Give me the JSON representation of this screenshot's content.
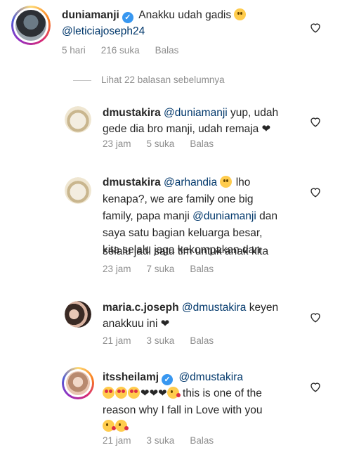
{
  "comment": {
    "username": "duniamanji",
    "text": "Anakku udah gadis",
    "emoji": "grinning-face",
    "mention": "@leticiajoseph24",
    "time": "5 hari",
    "likes": "216 suka",
    "reply": "Balas"
  },
  "view_previous": "Lihat 22 balasan sebelumnya",
  "replies": [
    {
      "username": "dmustakira",
      "mention": "@duniamanji",
      "line1": " yup, udah",
      "line2": "gede dia bro manji, udah remaja",
      "time": "23 jam",
      "likes": "5 suka",
      "reply": "Balas"
    },
    {
      "username": "dmustakira",
      "mention": "@arhandia",
      "line1_tail": "lho",
      "line2": "kenapa?, we are family one big",
      "line3_pre": "family, papa manji ",
      "line3_mention": "@duniamanji",
      "line3_post": " dan",
      "line4": "saya satu bagian keluarga besar,",
      "line5": "kita selalu jaga kekompakan dan",
      "line6": "selalu jadi satu tim untuk anak kita",
      "time": "23 jam",
      "likes": "7 suka",
      "reply": "Balas"
    },
    {
      "username": "maria.c.joseph",
      "mention": "@dmustakira",
      "line1_tail": " keyen",
      "line2": "anakkuu ini",
      "time": "21 jam",
      "likes": "3 suka",
      "reply": "Balas"
    },
    {
      "username": "itssheilamj",
      "mention": "@dmustakira",
      "line2_tail": " this is one of the",
      "line3": "reason why I fall in Love with you",
      "time": "21 jam",
      "likes": "3 suka",
      "reply": "Balas"
    }
  ],
  "colors": {
    "text": "#262626",
    "mention": "#00376b",
    "meta": "#8e8e8e",
    "verified": "#3897f0"
  }
}
